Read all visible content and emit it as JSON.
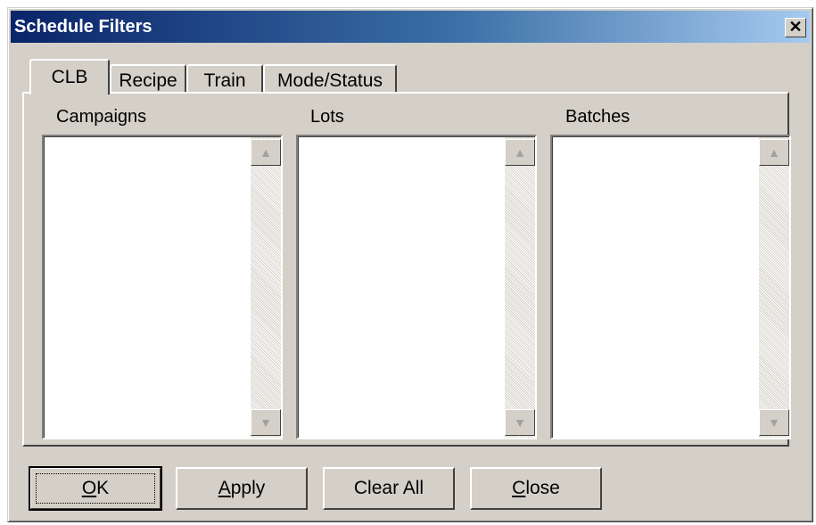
{
  "window": {
    "title": "Schedule Filters",
    "close_glyph": "✕"
  },
  "tabs": [
    {
      "label": "CLB",
      "active": true
    },
    {
      "label": "Recipe",
      "active": false
    },
    {
      "label": "Train",
      "active": false
    },
    {
      "label": "Mode/Status",
      "active": false
    }
  ],
  "lists": [
    {
      "label": "Campaigns",
      "items": []
    },
    {
      "label": "Lots",
      "items": []
    },
    {
      "label": "Batches",
      "items": []
    }
  ],
  "scroll": {
    "up_glyph": "▲",
    "down_glyph": "▼"
  },
  "buttons": {
    "ok": {
      "mnemonic": "O",
      "rest": "K"
    },
    "apply": {
      "mnemonic": "A",
      "rest": "pply"
    },
    "clear_all": {
      "label": "Clear All"
    },
    "close": {
      "mnemonic": "C",
      "rest": "lose"
    }
  }
}
